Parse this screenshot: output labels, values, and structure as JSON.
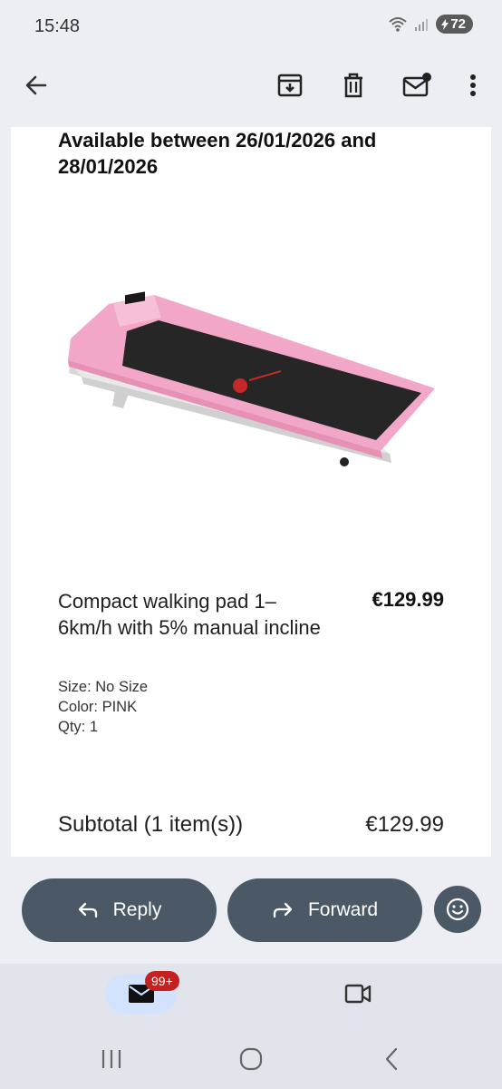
{
  "status": {
    "time": "15:48",
    "battery": "72"
  },
  "app_bar": {
    "back_icon": "arrow-left-icon",
    "archive_icon": "archive-icon",
    "delete_icon": "trash-icon",
    "unread_icon": "mark-unread-icon",
    "more_icon": "more-vert-icon"
  },
  "email": {
    "availability": "Available between 26/01/2026 and 28/01/2026",
    "product": {
      "name": "Compact walking pad 1–6km/h with 5% manual incline",
      "price": "€129.99",
      "size": "Size: No Size",
      "color": "Color: PINK",
      "qty": "Qty: 1"
    },
    "subtotal_label": "Subtotal (1 item(s))",
    "subtotal_value": "€129.99"
  },
  "actions": {
    "reply": "Reply",
    "forward": "Forward"
  },
  "bottom_nav": {
    "mail_badge": "99+"
  },
  "colors": {
    "accent_dark": "#4b5966",
    "badge": "#c5221f",
    "treadmill_pink": "#f2a6c8"
  }
}
